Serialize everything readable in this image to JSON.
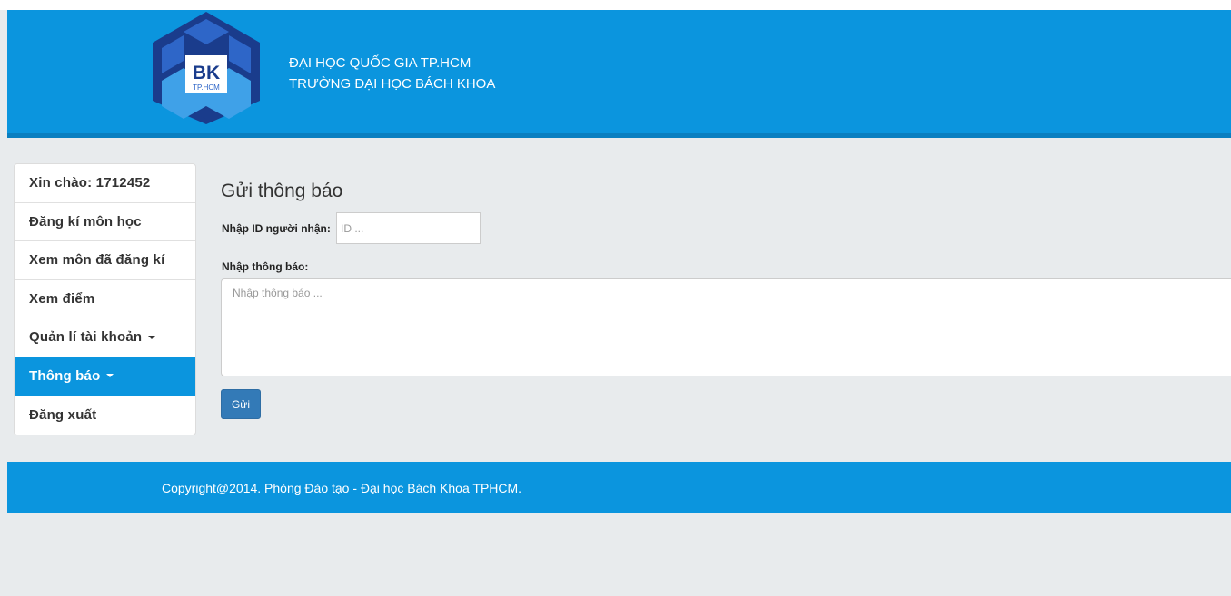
{
  "header": {
    "logo_text": "BK",
    "logo_subtext": "TP.HCM",
    "line1": "ĐẠI HỌC QUỐC GIA TP.HCM",
    "line2": "TRƯỜNG ĐẠI HỌC BÁCH KHOA"
  },
  "colors": {
    "brand_blue": "#0b95de",
    "logo_dark": "#1a3c8c",
    "logo_mid": "#2e66c8",
    "logo_light": "#3fa1e8",
    "button_blue": "#337ab7"
  },
  "sidebar": {
    "items": [
      {
        "label": "Xin chào: 1712452",
        "active": false
      },
      {
        "label": "Đăng kí môn học",
        "active": false
      },
      {
        "label": "Xem môn đã đăng kí",
        "active": false
      },
      {
        "label": "Xem điểm",
        "active": false
      },
      {
        "label": "Quản lí tài khoản",
        "active": false,
        "has_caret": true
      },
      {
        "label": "Thông báo",
        "active": true,
        "has_caret": true
      },
      {
        "label": "Đăng xuất",
        "active": false
      }
    ]
  },
  "main": {
    "title": "Gửi thông báo",
    "recipient_label": "Nhập ID người nhận:",
    "recipient_placeholder": "ID ...",
    "recipient_value": "",
    "message_label": "Nhập thông báo:",
    "message_placeholder": "Nhập thông báo ...",
    "message_value": "",
    "send_label": "Gửi"
  },
  "footer": {
    "text": "Copyright@2014. Phòng Đào tạo - Đại học Bách Khoa TPHCM."
  }
}
